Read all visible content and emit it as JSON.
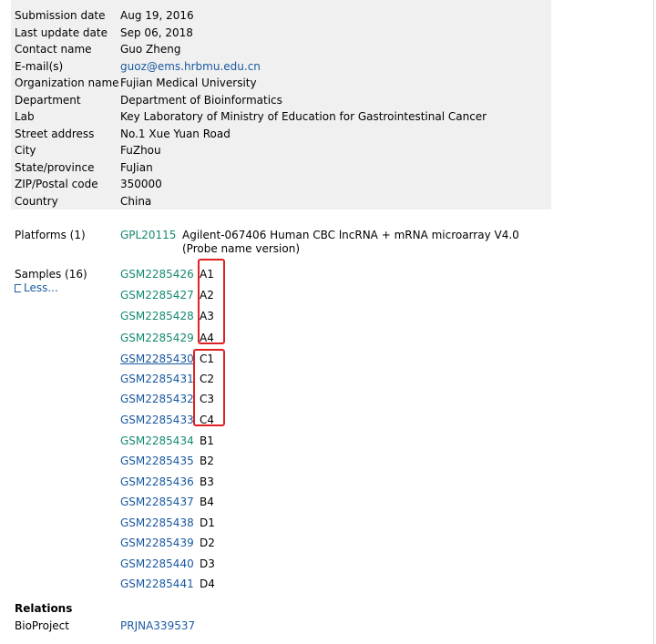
{
  "contact": [
    {
      "label": "Submission date",
      "value": "Aug 19, 2016"
    },
    {
      "label": "Last update date",
      "value": "Sep 06, 2018"
    },
    {
      "label": "Contact name",
      "value": "Guo Zheng"
    },
    {
      "label": "E-mail(s)",
      "value": "guoz@ems.hrbmu.edu.cn",
      "link": true
    },
    {
      "label": "Organization name",
      "value": "Fujian Medical University"
    },
    {
      "label": "Department",
      "value": "Department of Bioinformatics"
    },
    {
      "label": "Lab",
      "value": "Key Laboratory of Ministry of Education for Gastrointestinal Cancer"
    },
    {
      "label": "Street address",
      "value": "No.1 Xue Yuan Road"
    },
    {
      "label": "City",
      "value": "FuZhou"
    },
    {
      "label": "State/province",
      "value": "FuJian"
    },
    {
      "label": "ZIP/Postal code",
      "value": "350000"
    },
    {
      "label": "Country",
      "value": "China"
    }
  ],
  "platforms": {
    "label": "Platforms (1)",
    "id": "GPL20115",
    "title_line1": "Agilent-067406 Human CBC lncRNA + mRNA microarray V4.0",
    "title_line2": "(Probe name version)"
  },
  "samples": {
    "label": "Samples (16)",
    "less_label": "Less...",
    "items": [
      {
        "id": "GSM2285426",
        "title": "A1"
      },
      {
        "id": "GSM2285427",
        "title": "A2"
      },
      {
        "id": "GSM2285428",
        "title": "A3"
      },
      {
        "id": "GSM2285429",
        "title": "A4"
      },
      {
        "id": "GSM2285430",
        "title": "C1"
      },
      {
        "id": "GSM2285431",
        "title": "C2"
      },
      {
        "id": "GSM2285432",
        "title": "C3"
      },
      {
        "id": "GSM2285433",
        "title": "C4"
      },
      {
        "id": "GSM2285434",
        "title": "B1"
      },
      {
        "id": "GSM2285435",
        "title": "B2"
      },
      {
        "id": "GSM2285436",
        "title": "B3"
      },
      {
        "id": "GSM2285437",
        "title": "B4"
      },
      {
        "id": "GSM2285438",
        "title": "D1"
      },
      {
        "id": "GSM2285439",
        "title": "D2"
      },
      {
        "id": "GSM2285440",
        "title": "D3"
      },
      {
        "id": "GSM2285441",
        "title": "D4"
      }
    ]
  },
  "relations": {
    "heading": "Relations",
    "label": "BioProject",
    "value": "PRJNA339537"
  },
  "colors": {
    "link_blue": "#1a5aa0",
    "link_teal": "#158a72",
    "highlight_red": "#e02020",
    "panel_bg": "#f0f0f0"
  }
}
